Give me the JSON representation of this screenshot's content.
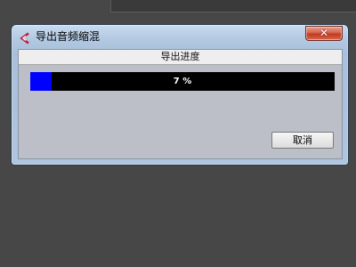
{
  "dialog": {
    "title": "导出音频缩混",
    "app_icon": "cubase-logo-icon",
    "close_label": "✕",
    "section_title": "导出进度",
    "progress": {
      "value": 0.07,
      "label": "7 %",
      "fill_color": "#0000ff",
      "track_color": "#000000"
    },
    "cancel_label": "取消"
  }
}
